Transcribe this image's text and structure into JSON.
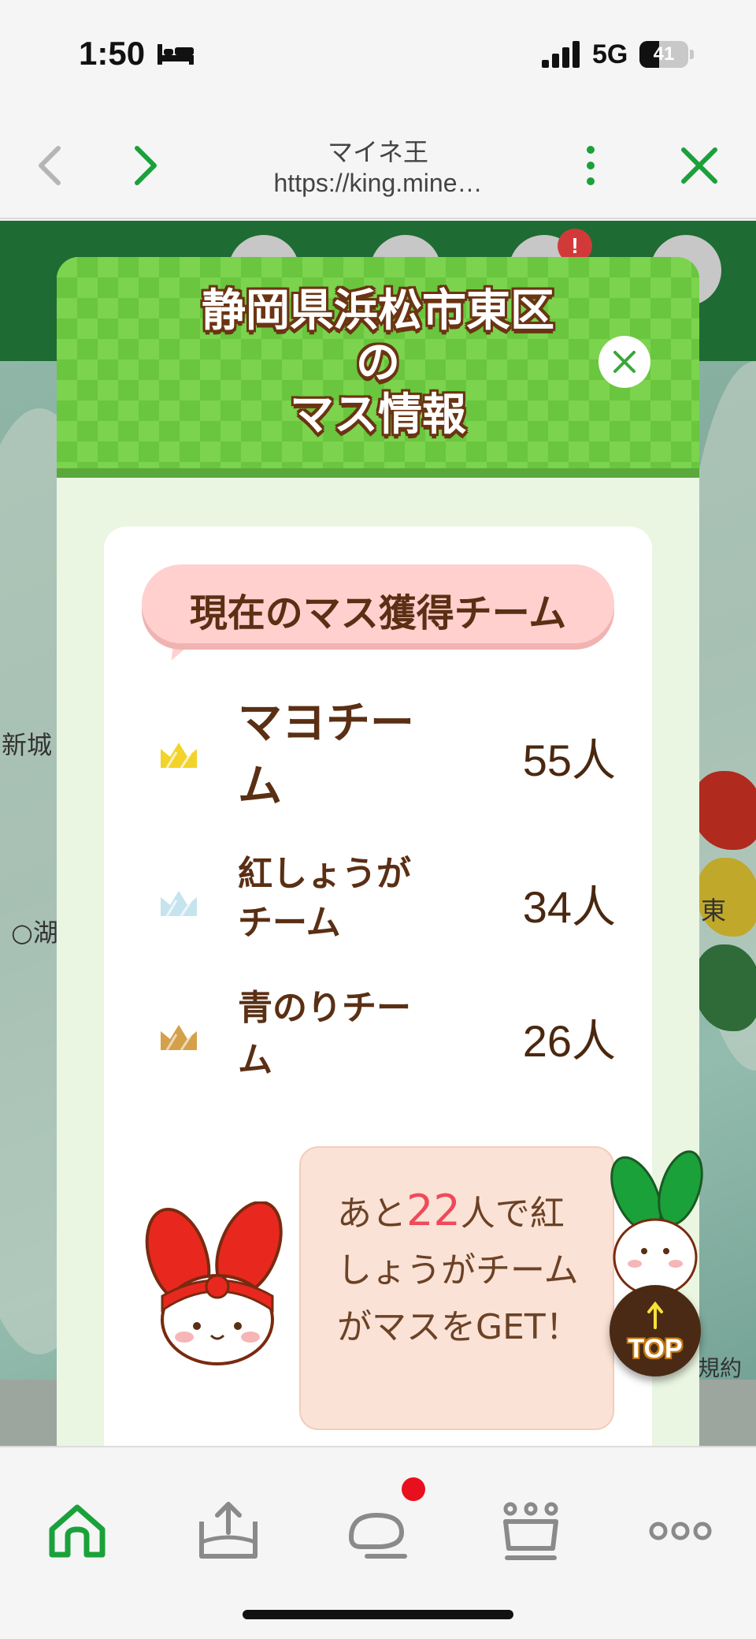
{
  "status_bar": {
    "time": "1:50",
    "network": "5G",
    "battery_level": 41,
    "battery_text": "41",
    "icons": [
      "bed-icon",
      "signal-icon",
      "battery-icon"
    ]
  },
  "browser": {
    "title": "マイネ王",
    "url": "https://king.mine…",
    "icons": [
      "back-icon",
      "forward-icon",
      "more-icon",
      "close-icon"
    ]
  },
  "background_page": {
    "map_labels": [
      "新城",
      "○湖",
      "東",
      "規約"
    ],
    "badge": "!"
  },
  "modal": {
    "title_line1": "静岡県浜松市東区",
    "title_line2": "の",
    "title_line3": "マス情報",
    "section_heading": "現在のマス獲得チーム",
    "teams": [
      {
        "rank": 1,
        "name": "マヨチーム",
        "members": "55人",
        "crown_color": "#f2d32a",
        "icon": "crown-gold-icon"
      },
      {
        "rank": 2,
        "name": "紅しょうがチーム",
        "members": "34人",
        "crown_color": "#c5e4ee",
        "icon": "crown-silver-icon"
      },
      {
        "rank": 3,
        "name": "青のりチーム",
        "members": "26人",
        "crown_color": "#d4a04a",
        "icon": "crown-bronze-icon"
      }
    ],
    "info": {
      "prefix": "あと",
      "count": "22",
      "suffix": "人で紅しょうがチームがマスをGET！"
    }
  },
  "floating_button": {
    "label": "TOP"
  },
  "tab_bar": {
    "tabs": [
      {
        "name": "home",
        "icon": "home-icon",
        "active": true
      },
      {
        "name": "upload",
        "icon": "upload-tray-icon",
        "active": false
      },
      {
        "name": "chat",
        "icon": "chat-icon",
        "active": false,
        "notification": true
      },
      {
        "name": "ranking",
        "icon": "crown-icon",
        "active": false
      },
      {
        "name": "more",
        "icon": "more-dots-icon",
        "active": false
      }
    ],
    "active_color": "#1aa13a",
    "inactive_color": "#8a8a8a"
  }
}
